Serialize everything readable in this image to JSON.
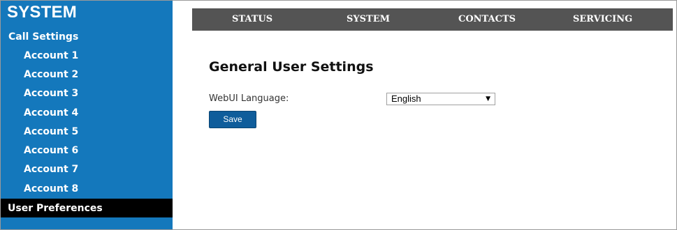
{
  "sidebar": {
    "title": "SYSTEM",
    "section_label": "Call Settings",
    "accounts": [
      "Account 1",
      "Account 2",
      "Account 3",
      "Account 4",
      "Account 5",
      "Account 6",
      "Account 7",
      "Account 8"
    ],
    "active_item": "User Preferences"
  },
  "topnav": {
    "items": [
      "STATUS",
      "SYSTEM",
      "CONTACTS",
      "SERVICING"
    ]
  },
  "content": {
    "title": "General User Settings",
    "language_label": "WebUI Language:",
    "language_value": "English",
    "save_label": "Save"
  },
  "colors": {
    "sidebar_bg": "#1478bc",
    "active_bg": "#000000",
    "nav_bg": "#545454",
    "button_bg": "#0f5d9b"
  },
  "icons": {
    "dropdown": "dropdown-arrow-icon"
  }
}
